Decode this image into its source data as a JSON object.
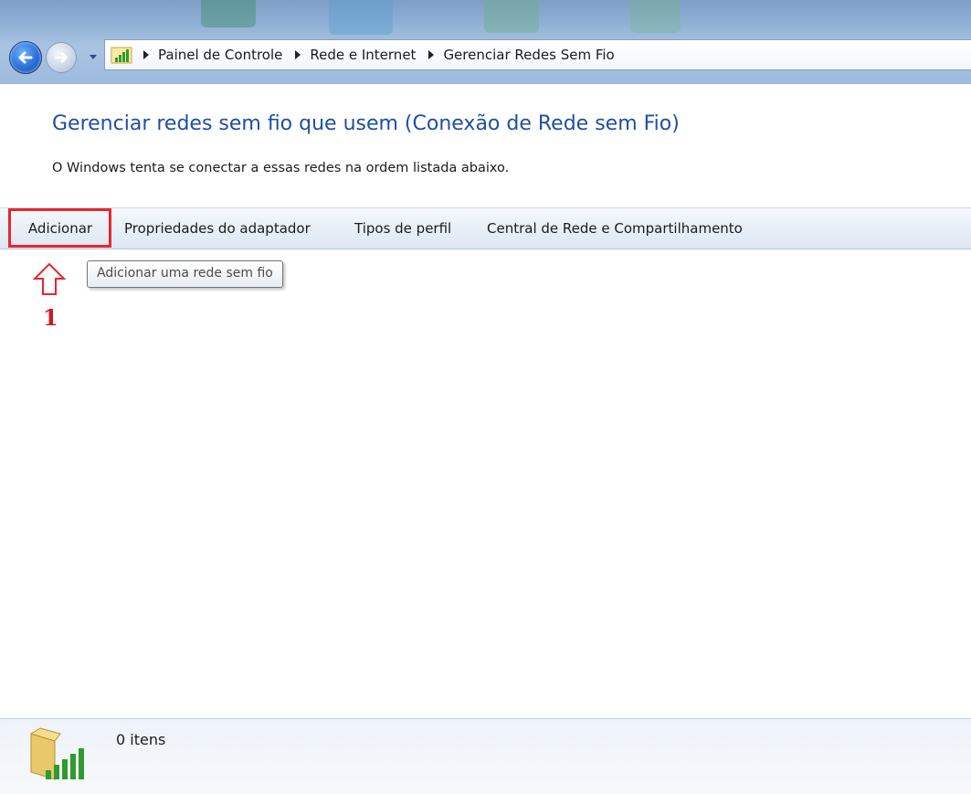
{
  "address_bar": {
    "breadcrumbs": [
      "Painel de Controle",
      "Rede e Internet",
      "Gerenciar Redes Sem Fio"
    ]
  },
  "header": {
    "title": "Gerenciar redes sem fio que usem (Conexão de Rede sem Fio)",
    "description": "O Windows tenta se conectar a essas redes na ordem listada abaixo."
  },
  "toolbar": {
    "items": [
      "Adicionar",
      "Propriedades do adaptador",
      "Tipos de perfil",
      "Central de Rede e Compartilhamento"
    ]
  },
  "tooltip": {
    "text": "Adicionar uma rede sem fio"
  },
  "annotation": {
    "step_number": "1",
    "highlight_color": "#e8262c"
  },
  "details_pane": {
    "item_count": "0 itens"
  },
  "icons": {
    "back": "back-arrow-icon",
    "forward": "forward-arrow-icon",
    "recent": "chevron-down-icon",
    "address": "network-signal-icon",
    "details": "wireless-network-folder-icon"
  },
  "colors": {
    "title": "#1e4fa3",
    "accent": "#2a6fd6"
  }
}
